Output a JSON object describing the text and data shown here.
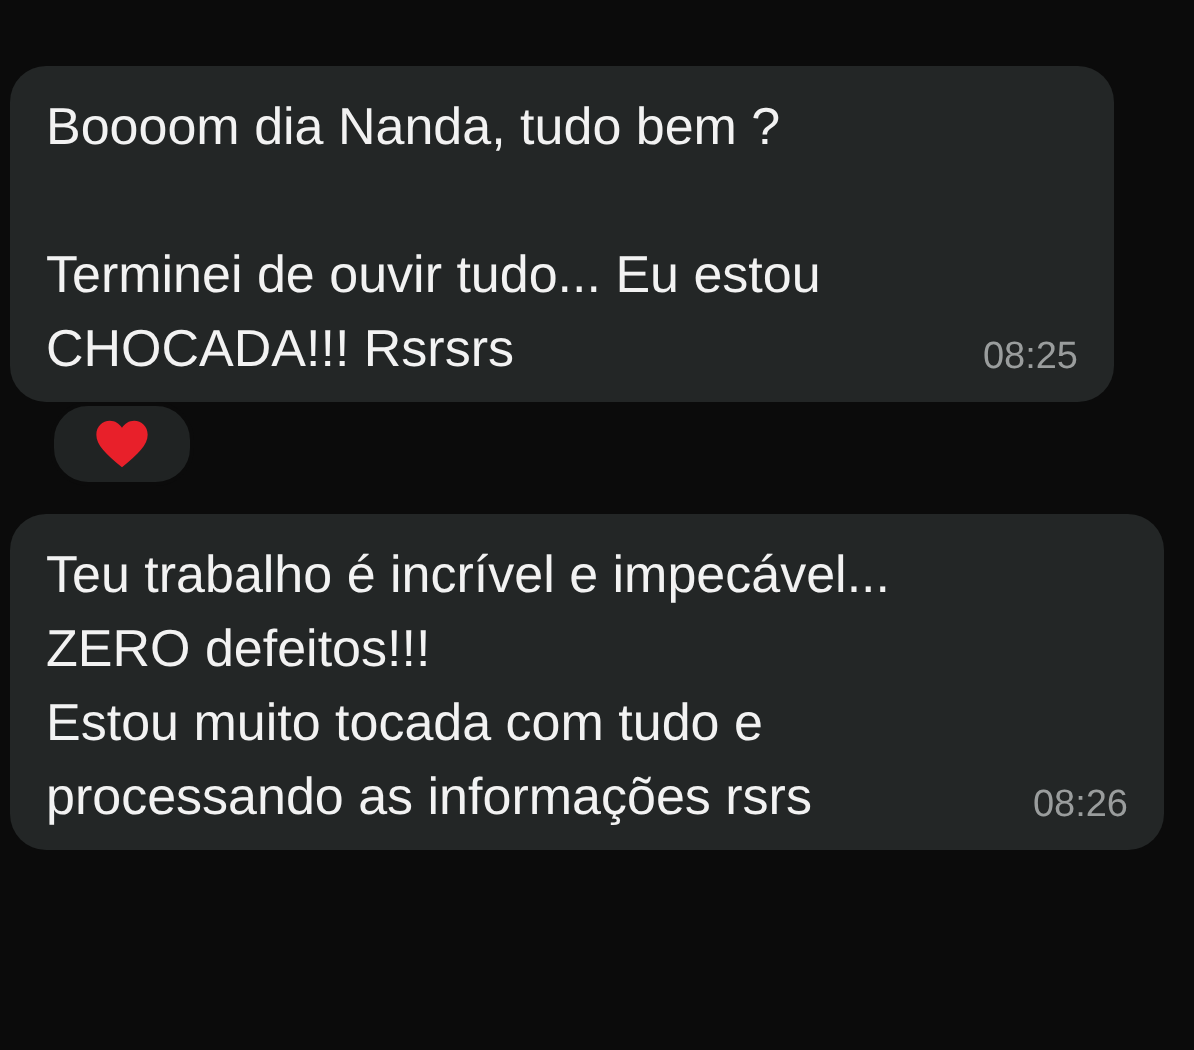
{
  "messages": [
    {
      "text": "Boooom dia Nanda, tudo bem ?\n\nTerminei de ouvir tudo... Eu estou\nCHOCADA!!! Rsrsrs",
      "time": "08:25",
      "reaction": {
        "kind": "heart"
      }
    },
    {
      "text": "Teu trabalho é incrível e impecável...\nZERO defeitos!!!\nEstou muito tocada com tudo e\nprocessando as informações rsrs",
      "time": "08:26"
    }
  ]
}
